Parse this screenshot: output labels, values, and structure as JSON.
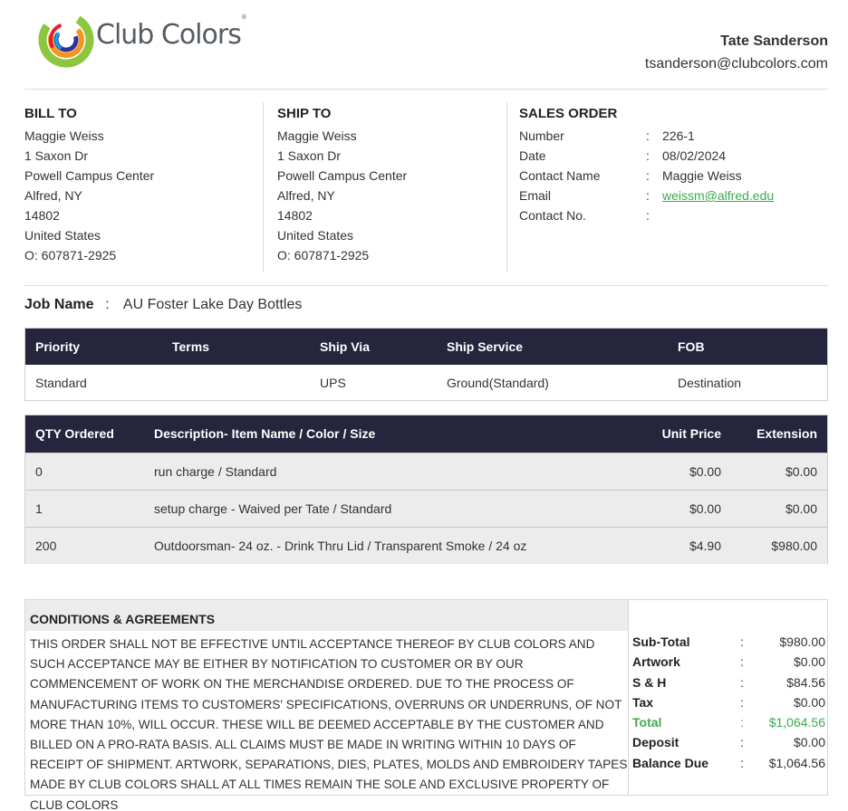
{
  "brand": {
    "logo_text": "Club Colors",
    "trademark": "®",
    "accent": "#3fa84d",
    "header_dark": "#25253e"
  },
  "rep": {
    "name": "Tate Sanderson",
    "email": "tsanderson@clubcolors.com"
  },
  "bill_to": {
    "title": "BILL TO",
    "lines": [
      "Maggie Weiss",
      "1 Saxon Dr",
      "Powell Campus Center",
      "Alfred, NY",
      "14802",
      "United States",
      "O: 607871-2925"
    ]
  },
  "ship_to": {
    "title": "SHIP TO",
    "lines": [
      "Maggie Weiss",
      "1 Saxon Dr",
      "Powell Campus Center",
      "Alfred, NY",
      "14802",
      "United States",
      "O: 607871-2925"
    ]
  },
  "sales_order": {
    "title": "SALES ORDER",
    "rows": [
      {
        "label": "Number",
        "value": "226-1"
      },
      {
        "label": "Date",
        "value": "08/02/2024"
      },
      {
        "label": "Contact Name",
        "value": "Maggie Weiss"
      },
      {
        "label": "Email",
        "value": "weissm@alfred.edu"
      },
      {
        "label": "Contact No.",
        "value": ""
      }
    ],
    "colon": ":"
  },
  "job": {
    "label": "Job Name",
    "colon": ":",
    "value": "AU Foster Lake Day Bottles"
  },
  "shipping_table": {
    "headers": [
      "Priority",
      "Terms",
      "Ship Via",
      "Ship Service",
      "FOB"
    ],
    "row": [
      "Standard",
      "",
      "UPS",
      "Ground(Standard)",
      "Destination"
    ]
  },
  "items_table": {
    "headers": [
      "QTY Ordered",
      "Description- Item Name / Color / Size",
      "Unit Price",
      "Extension"
    ],
    "rows": [
      [
        "0",
        "run charge / Standard",
        "$0.00",
        "$0.00"
      ],
      [
        "1",
        "setup charge - Waived per Tate / Standard",
        "$0.00",
        "$0.00"
      ],
      [
        "200",
        "Outdoorsman- 24 oz. - Drink Thru Lid / Transparent Smoke / 24 oz",
        "$4.90",
        "$980.00"
      ]
    ]
  },
  "conditions": {
    "title": "CONDITIONS & AGREEMENTS",
    "text": "THIS ORDER SHALL NOT BE EFFECTIVE UNTIL ACCEPTANCE THEREOF BY CLUB COLORS AND SUCH ACCEPTANCE MAY BE EITHER BY NOTIFICATION TO CUSTOMER OR BY OUR COMMENCEMENT OF WORK ON THE MERCHANDISE ORDERED. DUE TO THE PROCESS OF MANUFACTURING ITEMS TO CUSTOMERS' SPECIFICATIONS, OVERRUNS OR UNDERRUNS, OF NOT MORE THAN 10%, WILL OCCUR. THESE WILL BE DEEMED ACCEPTABLE BY THE CUSTOMER AND BILLED ON A PRO-RATA BASIS. ALL CLAIMS MUST BE MADE IN WRITING WITHIN 10 DAYS OF RECEIPT OF SHIPMENT. ARTWORK, SEPARATIONS, DIES, PLATES, MOLDS AND EMBROIDERY TAPES MADE BY CLUB COLORS SHALL AT ALL TIMES REMAIN THE SOLE AND EXCLUSIVE PROPERTY OF CLUB COLORS"
  },
  "totals": {
    "colon": ":",
    "rows": [
      {
        "label": "Sub-Total",
        "value": "$980.00"
      },
      {
        "label": "Artwork",
        "value": "$0.00"
      },
      {
        "label": "S & H",
        "value": "$84.56"
      },
      {
        "label": "Tax",
        "value": "$0.00"
      },
      {
        "label": "Total",
        "value": "$1,064.56"
      },
      {
        "label": "Deposit",
        "value": "$0.00"
      },
      {
        "label": "Balance Due",
        "value": "$1,064.56"
      }
    ]
  }
}
